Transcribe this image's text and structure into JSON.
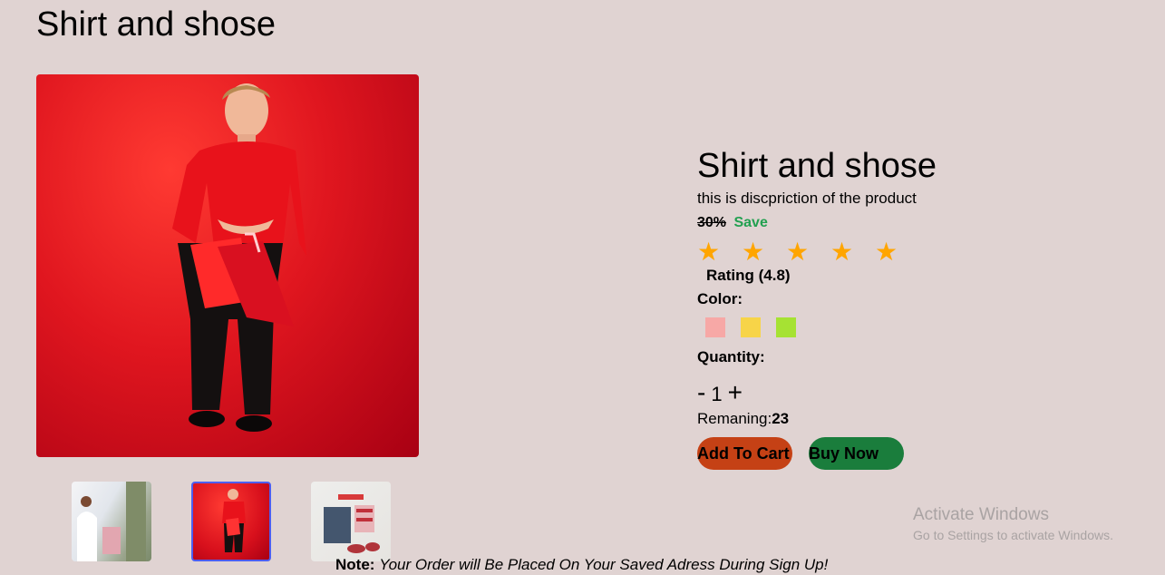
{
  "page": {
    "title": "Shirt and shose"
  },
  "product": {
    "name": "Shirt and shose",
    "description": "this is discpriction of the product",
    "discount": "30%",
    "save_label": "Save",
    "stars": [
      "★",
      "★",
      "★",
      "★",
      "★"
    ],
    "star_color": "#ffa500",
    "rating_text": "Rating (4.8)",
    "color_label": "Color:",
    "colors": [
      "#f7a8a6",
      "#f7d448",
      "#a6e233"
    ],
    "quantity_label": "Quantity:",
    "quantity": "1",
    "minus": "-",
    "plus": "+",
    "remaining_label": "Remaning:",
    "remaining_value": "23",
    "add_to_cart": "Add To Cart",
    "buy_now": "Buy Now",
    "add_to_cart_color": "#c54115",
    "buy_now_color": "#1a7d3c"
  },
  "gallery": {
    "selected_index": 1,
    "thumbnail_count": 3
  },
  "note": {
    "label": "Note:",
    "text": "Your Order will Be Placed On Your Saved Adress During Sign Up!"
  },
  "watermark": {
    "title": "Activate Windows",
    "subtitle": "Go to Settings to activate Windows."
  }
}
